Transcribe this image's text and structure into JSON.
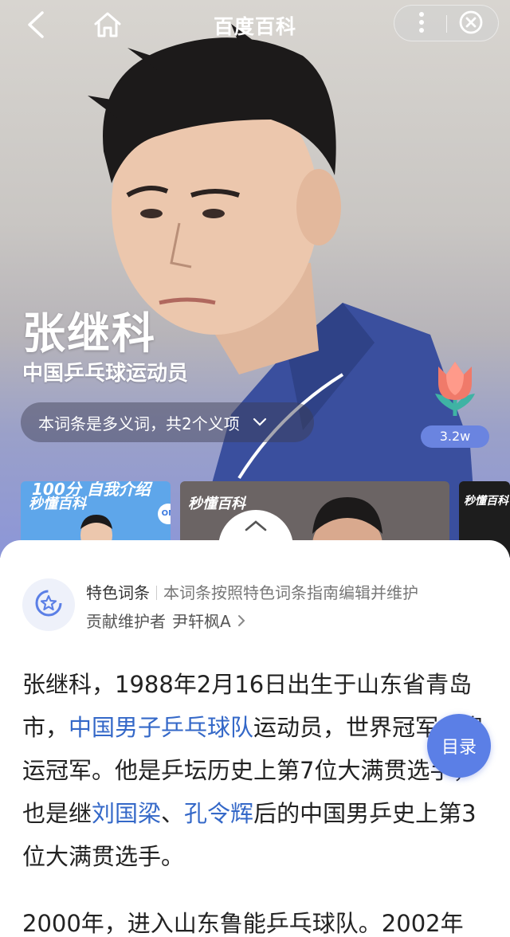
{
  "header": {
    "title": "百度百科",
    "back_icon": "back-arrow-icon",
    "home_icon": "home-icon",
    "more_icon": "more-vertical-icon",
    "close_icon": "close-circle-icon"
  },
  "hero": {
    "name": "张继科",
    "subtitle": "中国乒乓球运动员",
    "polysemy_label": "本词条是多义词，共2个义项",
    "like_count": "3.2w",
    "thumbnails": [
      {
        "top_text": "100分 自我介绍",
        "logo": "秒懂百科",
        "badge": "ON"
      },
      {
        "logo": "秒懂百科"
      },
      {
        "logo": "秒懂百科"
      }
    ]
  },
  "feature": {
    "title": "特色词条",
    "description": "本词条按照特色词条指南编辑并维护",
    "contributor_label": "贡献维护者",
    "contributor_name": "尹轩枫A"
  },
  "content": {
    "p1_a": "张继科，1988年2月16日出生于山东省青岛市，",
    "p1_link1": "中国男子乒乓球队",
    "p1_b": "运动员，世界冠军，奥运冠军。他是乒坛历史上第7位大满贯选手，也是继",
    "p1_link2": "刘国梁",
    "p1_c": "、",
    "p1_link3": "孔令辉",
    "p1_d": "后的中国男乒史上第3位大满贯选手。",
    "p2": "2000年，进入山东鲁能乒乓球队。2002年"
  },
  "toc_button": "目录",
  "colors": {
    "link": "#3468c8",
    "accent": "#5b7fe6"
  }
}
